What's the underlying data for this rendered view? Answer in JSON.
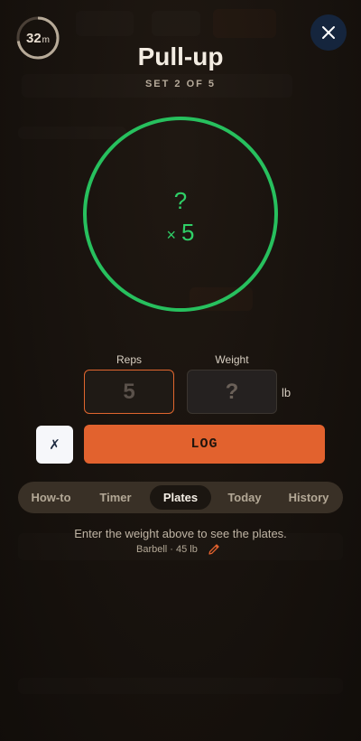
{
  "timer": {
    "value": "32",
    "unit": "m"
  },
  "exercise": {
    "name": "Pull-up",
    "set_label": "SET 2 OF 5"
  },
  "target": {
    "weight": "?",
    "reps_prefix": "×",
    "reps": "5"
  },
  "inputs": {
    "reps_label": "Reps",
    "reps_placeholder": "5",
    "weight_label": "Weight",
    "weight_placeholder": "?",
    "unit": "lb"
  },
  "actions": {
    "skip_label": "✗",
    "log_label": "LOG"
  },
  "tabs": [
    {
      "label": "How-to"
    },
    {
      "label": "Timer"
    },
    {
      "label": "Plates",
      "active": true
    },
    {
      "label": "Today"
    },
    {
      "label": "History"
    }
  ],
  "plates": {
    "hint": "Enter the weight above to see the plates.",
    "barbell": "Barbell · 45 lb"
  },
  "colors": {
    "accent": "#e2622e",
    "target_ring": "#27c05e",
    "close_bg": "#15253d"
  }
}
